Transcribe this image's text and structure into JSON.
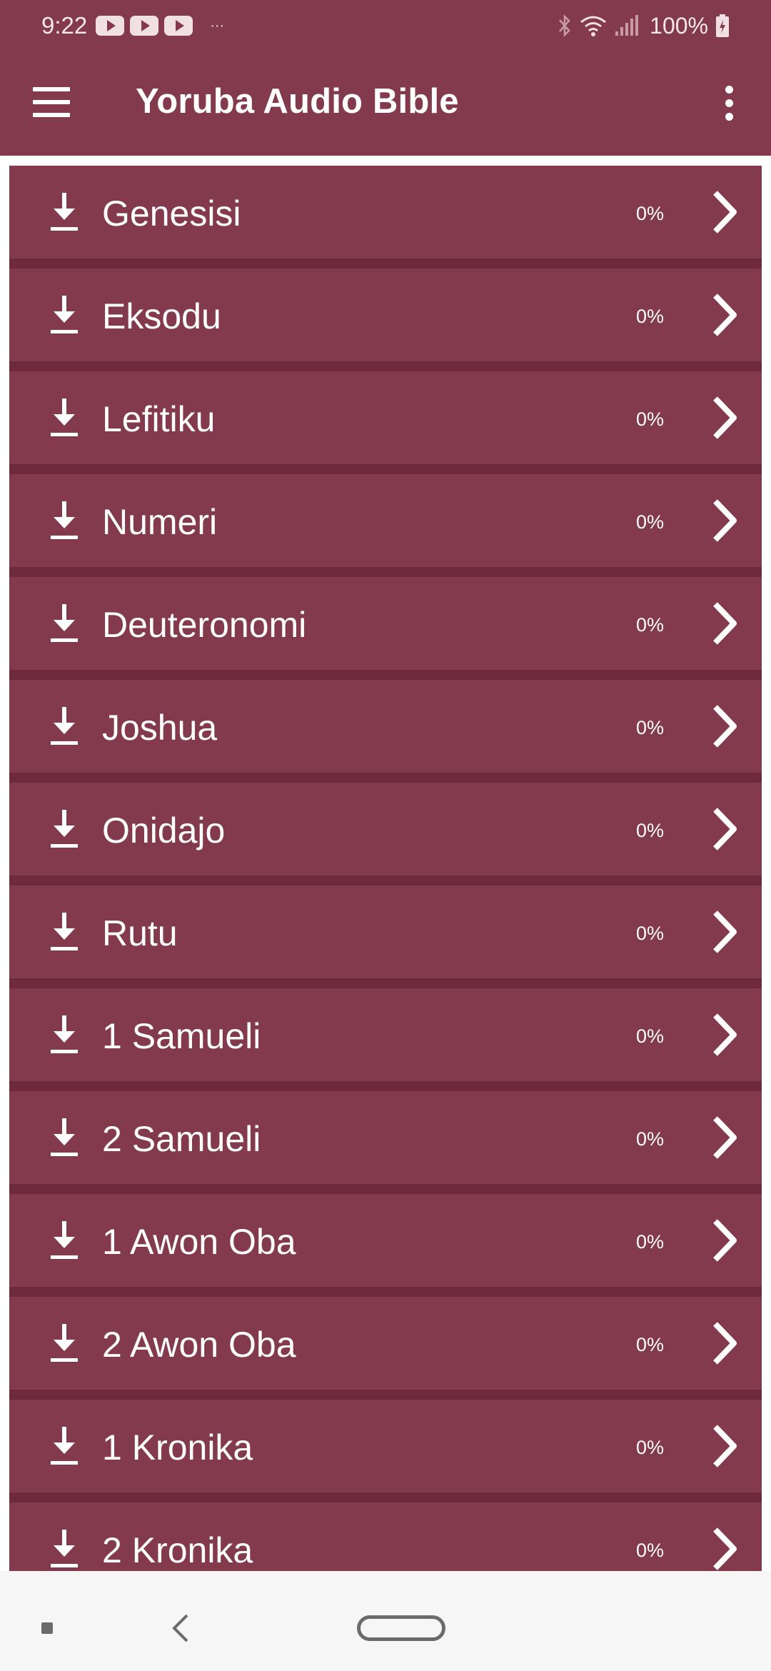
{
  "status_bar": {
    "time": "9:22",
    "overflow": "···",
    "battery": "100%",
    "icons": [
      "youtube-icon",
      "youtube-icon",
      "youtube-icon",
      "bluetooth-icon",
      "wifi-icon",
      "signal-icon",
      "battery-icon"
    ]
  },
  "app_bar": {
    "title": "Yoruba Audio Bible",
    "menu_icon": "hamburger-menu-icon",
    "more_icon": "more-vertical-icon"
  },
  "books": [
    {
      "name": "Genesisi",
      "progress": "0%"
    },
    {
      "name": "Eksodu",
      "progress": "0%"
    },
    {
      "name": "Lefitiku",
      "progress": "0%"
    },
    {
      "name": "Numeri",
      "progress": "0%"
    },
    {
      "name": "Deuteronomi",
      "progress": "0%"
    },
    {
      "name": "Joshua",
      "progress": "0%"
    },
    {
      "name": "Onidajo",
      "progress": "0%"
    },
    {
      "name": "Rutu",
      "progress": "0%"
    },
    {
      "name": "1 Samueli",
      "progress": "0%"
    },
    {
      "name": "2 Samueli",
      "progress": "0%"
    },
    {
      "name": "1 Awon Oba",
      "progress": "0%"
    },
    {
      "name": "2 Awon Oba",
      "progress": "0%"
    },
    {
      "name": "1 Kronika",
      "progress": "0%"
    },
    {
      "name": "2 Kronika",
      "progress": "0%"
    }
  ],
  "row_icons": {
    "leading": "download-icon",
    "trailing": "chevron-right-icon"
  },
  "colors": {
    "primary": "#843a4d",
    "divider": "#6e2a3c",
    "text": "#ffffff",
    "nav_background": "#f6f6f6"
  },
  "nav_bar": {
    "icons": [
      "recents-icon",
      "back-icon",
      "home-icon"
    ]
  }
}
